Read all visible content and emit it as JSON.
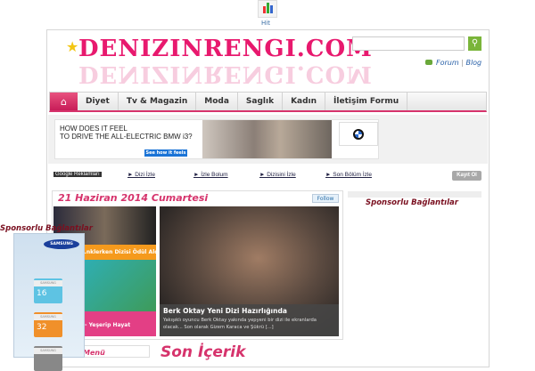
{
  "top_widget": {
    "label": "Hit"
  },
  "logo": {
    "text": "DENIZINRENGI.COM"
  },
  "header": {
    "search_placeholder": "",
    "forum": "Forum",
    "separator": "|",
    "blog": "Blog"
  },
  "nav": {
    "items": [
      "Diyet",
      "Tv & Magazin",
      "Moda",
      "Saglık",
      "Kadın",
      "İletişim Formu"
    ]
  },
  "ad": {
    "line1": "HOW DOES IT FEEL",
    "line2": "TO DRIVE THE ALL-ELECTRIC BMW i3?",
    "cta": "See how it feels"
  },
  "link_row": {
    "google": "Google Reklamları",
    "links": [
      "► Dizi İzle",
      "► İzle Bolum",
      "► Dizisini İzle",
      "► Son Bölüm İzle"
    ],
    "register": "Kayıt Ol"
  },
  "featured": {
    "date": "21 Haziran 2014 Cumartesi",
    "follow": "Follow",
    "thumbs": [
      "...nklerken Dizisi Ödül Aldı",
      "- Yeşerip Hayat"
    ],
    "headline": "Berk Oktay Yeni Dizi Hazırlığında",
    "excerpt": "Yakışıklı oyuncu Berk Oktay yakında yepyeni bir dizi ile ekranlarda olacak... Son olarak Gizem Karaca ve Şükrü [...]"
  },
  "sidebar": {
    "title": "Sponsorlu Bağlantılar"
  },
  "floating_ad": {
    "title": "Sponsorlu Bağlantılar",
    "brand": "SAMSUNG",
    "cards": [
      "16",
      "32"
    ]
  },
  "bottom": {
    "recent": "Son İçerik",
    "menu": "Menü"
  }
}
